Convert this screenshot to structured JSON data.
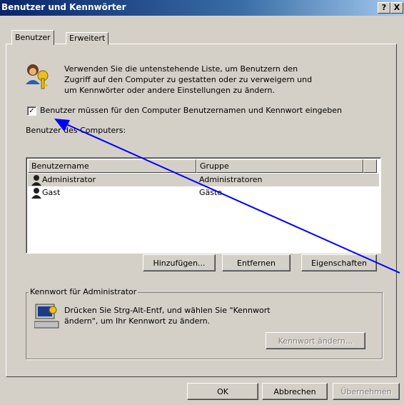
{
  "window": {
    "title": "Benutzer und Kennwörter",
    "help_btn": "?",
    "close_btn": "X"
  },
  "tabs": [
    {
      "label": "Benutzer",
      "active": true
    },
    {
      "label": "Erweitert",
      "active": false
    }
  ],
  "intro": {
    "line1": "Verwenden Sie die untenstehende Liste, um Benutzern den",
    "line2": "Zugriff auf den Computer zu gestatten oder zu verweigern und",
    "line3": "um Kennwörter oder andere Einstellungen zu ändern.",
    "icon": "users-keys-icon"
  },
  "require_login": {
    "checked": true,
    "check_glyph": "✓",
    "label": "Benutzer müssen für den Computer Benutzernamen und Kennwort eingeben"
  },
  "users_label": "Benutzer des Computers:",
  "user_list": {
    "columns": [
      "Benutzername",
      "Gruppe"
    ],
    "rows": [
      {
        "name": "Administrator",
        "group": "Administratoren",
        "selected": true
      },
      {
        "name": "Gast",
        "group": "Gäste",
        "selected": false
      }
    ]
  },
  "list_buttons": {
    "add": "Hinzufügen...",
    "remove": "Entfernen",
    "properties": "Eigenschaften"
  },
  "password_group": {
    "label": "Kennwort für Administrator",
    "line1": "Drücken Sie Strg-Alt-Entf, und wählen Sie \"Kennwort",
    "line2": "ändern\", um Ihr Kennwort zu ändern.",
    "button": "Kennwort ändern...",
    "icon": "computer-key-icon"
  },
  "footer": {
    "ok": "OK",
    "cancel": "Abbrechen",
    "apply": "Übernehmen"
  },
  "annotation": {
    "arrow_color": "#0000ff"
  }
}
